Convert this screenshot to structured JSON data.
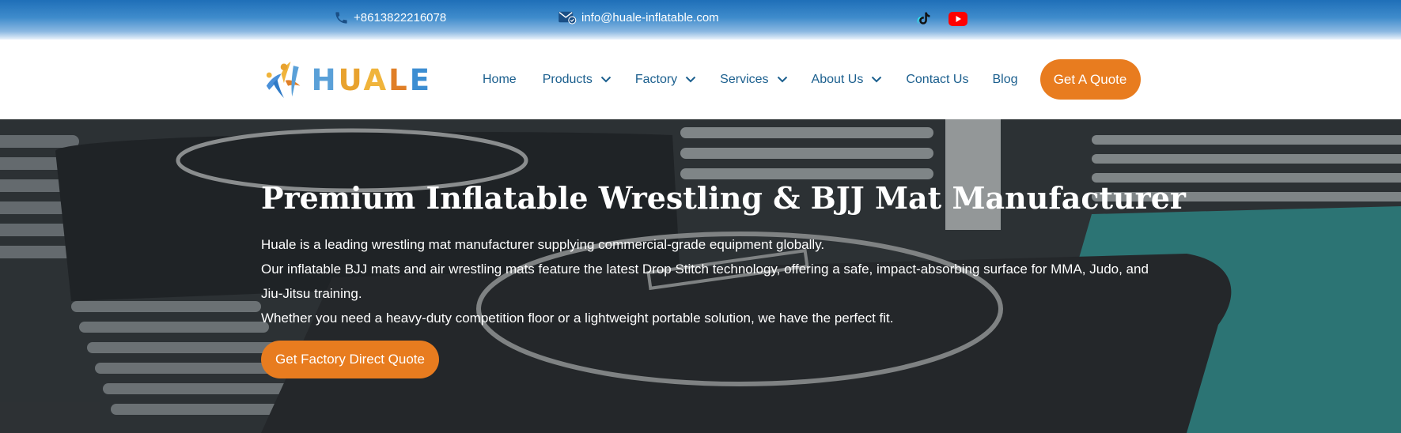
{
  "topbar": {
    "phone": "+8613822216078",
    "email": "info@huale-inflatable.com",
    "phone_icon": "phone-icon",
    "email_icon": "email-icon",
    "social": [
      {
        "name": "tiktok-icon"
      },
      {
        "name": "youtube-icon"
      }
    ]
  },
  "header": {
    "logo_text": [
      "H",
      "U",
      "A",
      "L",
      "E"
    ],
    "nav": {
      "home": "Home",
      "products": "Products",
      "factory": "Factory",
      "services": "Services",
      "about": "About Us",
      "contact": "Contact Us",
      "blog": "Blog"
    },
    "quote_button": "Get A Quote"
  },
  "hero": {
    "title": "Premium Inflatable Wrestling & BJJ Mat Manufacturer",
    "paragraphs": [
      "Huale is a leading wrestling mat manufacturer supplying commercial-grade equipment globally.",
      "Our inflatable BJJ mats and air wrestling mats feature the latest Drop Stitch technology, offering a safe, impact-absorbing surface for MMA, Judo, and Jiu-Jitsu training.",
      "Whether you need a heavy-duty competition floor or a lightweight portable solution, we have the perfect fit."
    ],
    "cta": "Get Factory Direct Quote"
  },
  "colors": {
    "accent": "#e87c1f",
    "nav_text": "#1b5f8e",
    "topbar": "#1f6fb8"
  }
}
